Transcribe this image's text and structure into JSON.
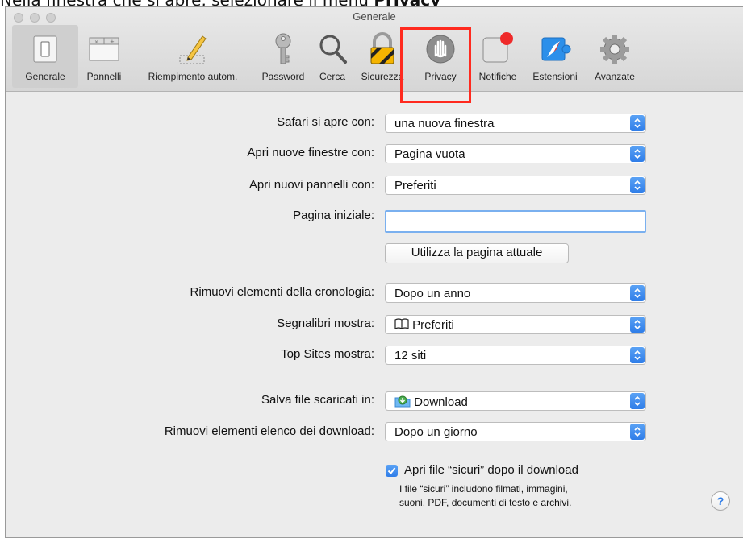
{
  "caption": {
    "prefix": "Nella finestra che si apre, selezionare il menù ",
    "bold": "Privacy"
  },
  "window": {
    "title": "Generale"
  },
  "toolbar": [
    {
      "label": "Generale",
      "icon": "switch-icon",
      "selected": true
    },
    {
      "label": "Pannelli",
      "icon": "tabs-icon"
    },
    {
      "label": "Riempimento autom.",
      "icon": "pencil-icon"
    },
    {
      "label": "Password",
      "icon": "key-icon"
    },
    {
      "label": "Cerca",
      "icon": "magnifier-icon"
    },
    {
      "label": "Sicurezza",
      "icon": "padlock-icon"
    },
    {
      "label": "Privacy",
      "icon": "hand-icon"
    },
    {
      "label": "Notifiche",
      "icon": "notification-badge-icon"
    },
    {
      "label": "Estensioni",
      "icon": "puzzle-compass-icon"
    },
    {
      "label": "Avanzate",
      "icon": "gear-icon"
    }
  ],
  "settings": {
    "safari_opens_label": "Safari si apre con:",
    "safari_opens_value": "una nuova finestra",
    "new_windows_label": "Apri nuove finestre con:",
    "new_windows_value": "Pagina vuota",
    "new_tabs_label": "Apri nuovi pannelli con:",
    "new_tabs_value": "Preferiti",
    "homepage_label": "Pagina iniziale:",
    "homepage_value": "",
    "use_current_button": "Utilizza la pagina attuale",
    "remove_history_label": "Rimuovi elementi della cronologia:",
    "remove_history_value": "Dopo un anno",
    "bookmarks_label": "Segnalibri mostra:",
    "bookmarks_value": "Preferiti",
    "topsites_label": "Top Sites mostra:",
    "topsites_value": "12 siti",
    "save_downloads_label": "Salva file scaricati in:",
    "save_downloads_value": "Download",
    "remove_downloads_label": "Rimuovi elementi elenco dei download:",
    "remove_downloads_value": "Dopo un giorno",
    "safe_files_label": "Apri file “sicuri” dopo il download",
    "safe_files_checked": true,
    "safe_files_note_line1": "I file “sicuri” includono filmati, immagini,",
    "safe_files_note_line2": "suoni, PDF, documenti di testo e archivi.",
    "help_label": "?"
  },
  "colors": {
    "accent": "#2f7de8",
    "highlight": "#ff2a1f"
  }
}
